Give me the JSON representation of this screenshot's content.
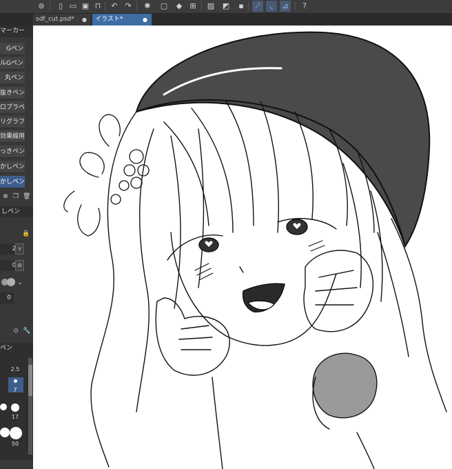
{
  "tabs": [
    {
      "label": "sdf_cut.psd*",
      "active": false
    },
    {
      "label": "イラスト*",
      "active": true
    }
  ],
  "toolbar": {
    "icons": [
      "app-menu-icon",
      "new-file-icon",
      "open-file-icon",
      "save-icon",
      "print-icon",
      "undo-icon",
      "redo-icon",
      "loading-icon",
      "clear-icon",
      "fill-icon",
      "transform-icon",
      "hide-selection-icon",
      "fill-selection-icon",
      "selection-launcher-icon",
      "snap-ruler-icon",
      "snap-special-ruler-icon",
      "snap-grid-icon",
      "help-icon"
    ]
  },
  "left_panel": {
    "header": "マーカー",
    "subtools": [
      {
        "label": "Gペン",
        "selected": false
      },
      {
        "label": "ルGペン",
        "selected": false
      },
      {
        "label": "丸ペン",
        "selected": false
      },
      {
        "label": "抜きペン",
        "selected": false
      },
      {
        "label": "ロプラペン",
        "selected": false
      },
      {
        "label": "リグラフィ",
        "selected": false
      },
      {
        "label": "効果線用",
        "selected": false
      },
      {
        "label": "っきペン",
        "selected": false
      },
      {
        "label": "かしペン",
        "selected": false
      },
      {
        "label": "かしペン",
        "selected": true
      }
    ],
    "prop_title": "しペン",
    "props": [
      "2.0",
      "0.0",
      "",
      "0"
    ],
    "brush_title": "ペン",
    "brush_sizes": [
      "2.5",
      "7",
      "17",
      "50"
    ]
  }
}
